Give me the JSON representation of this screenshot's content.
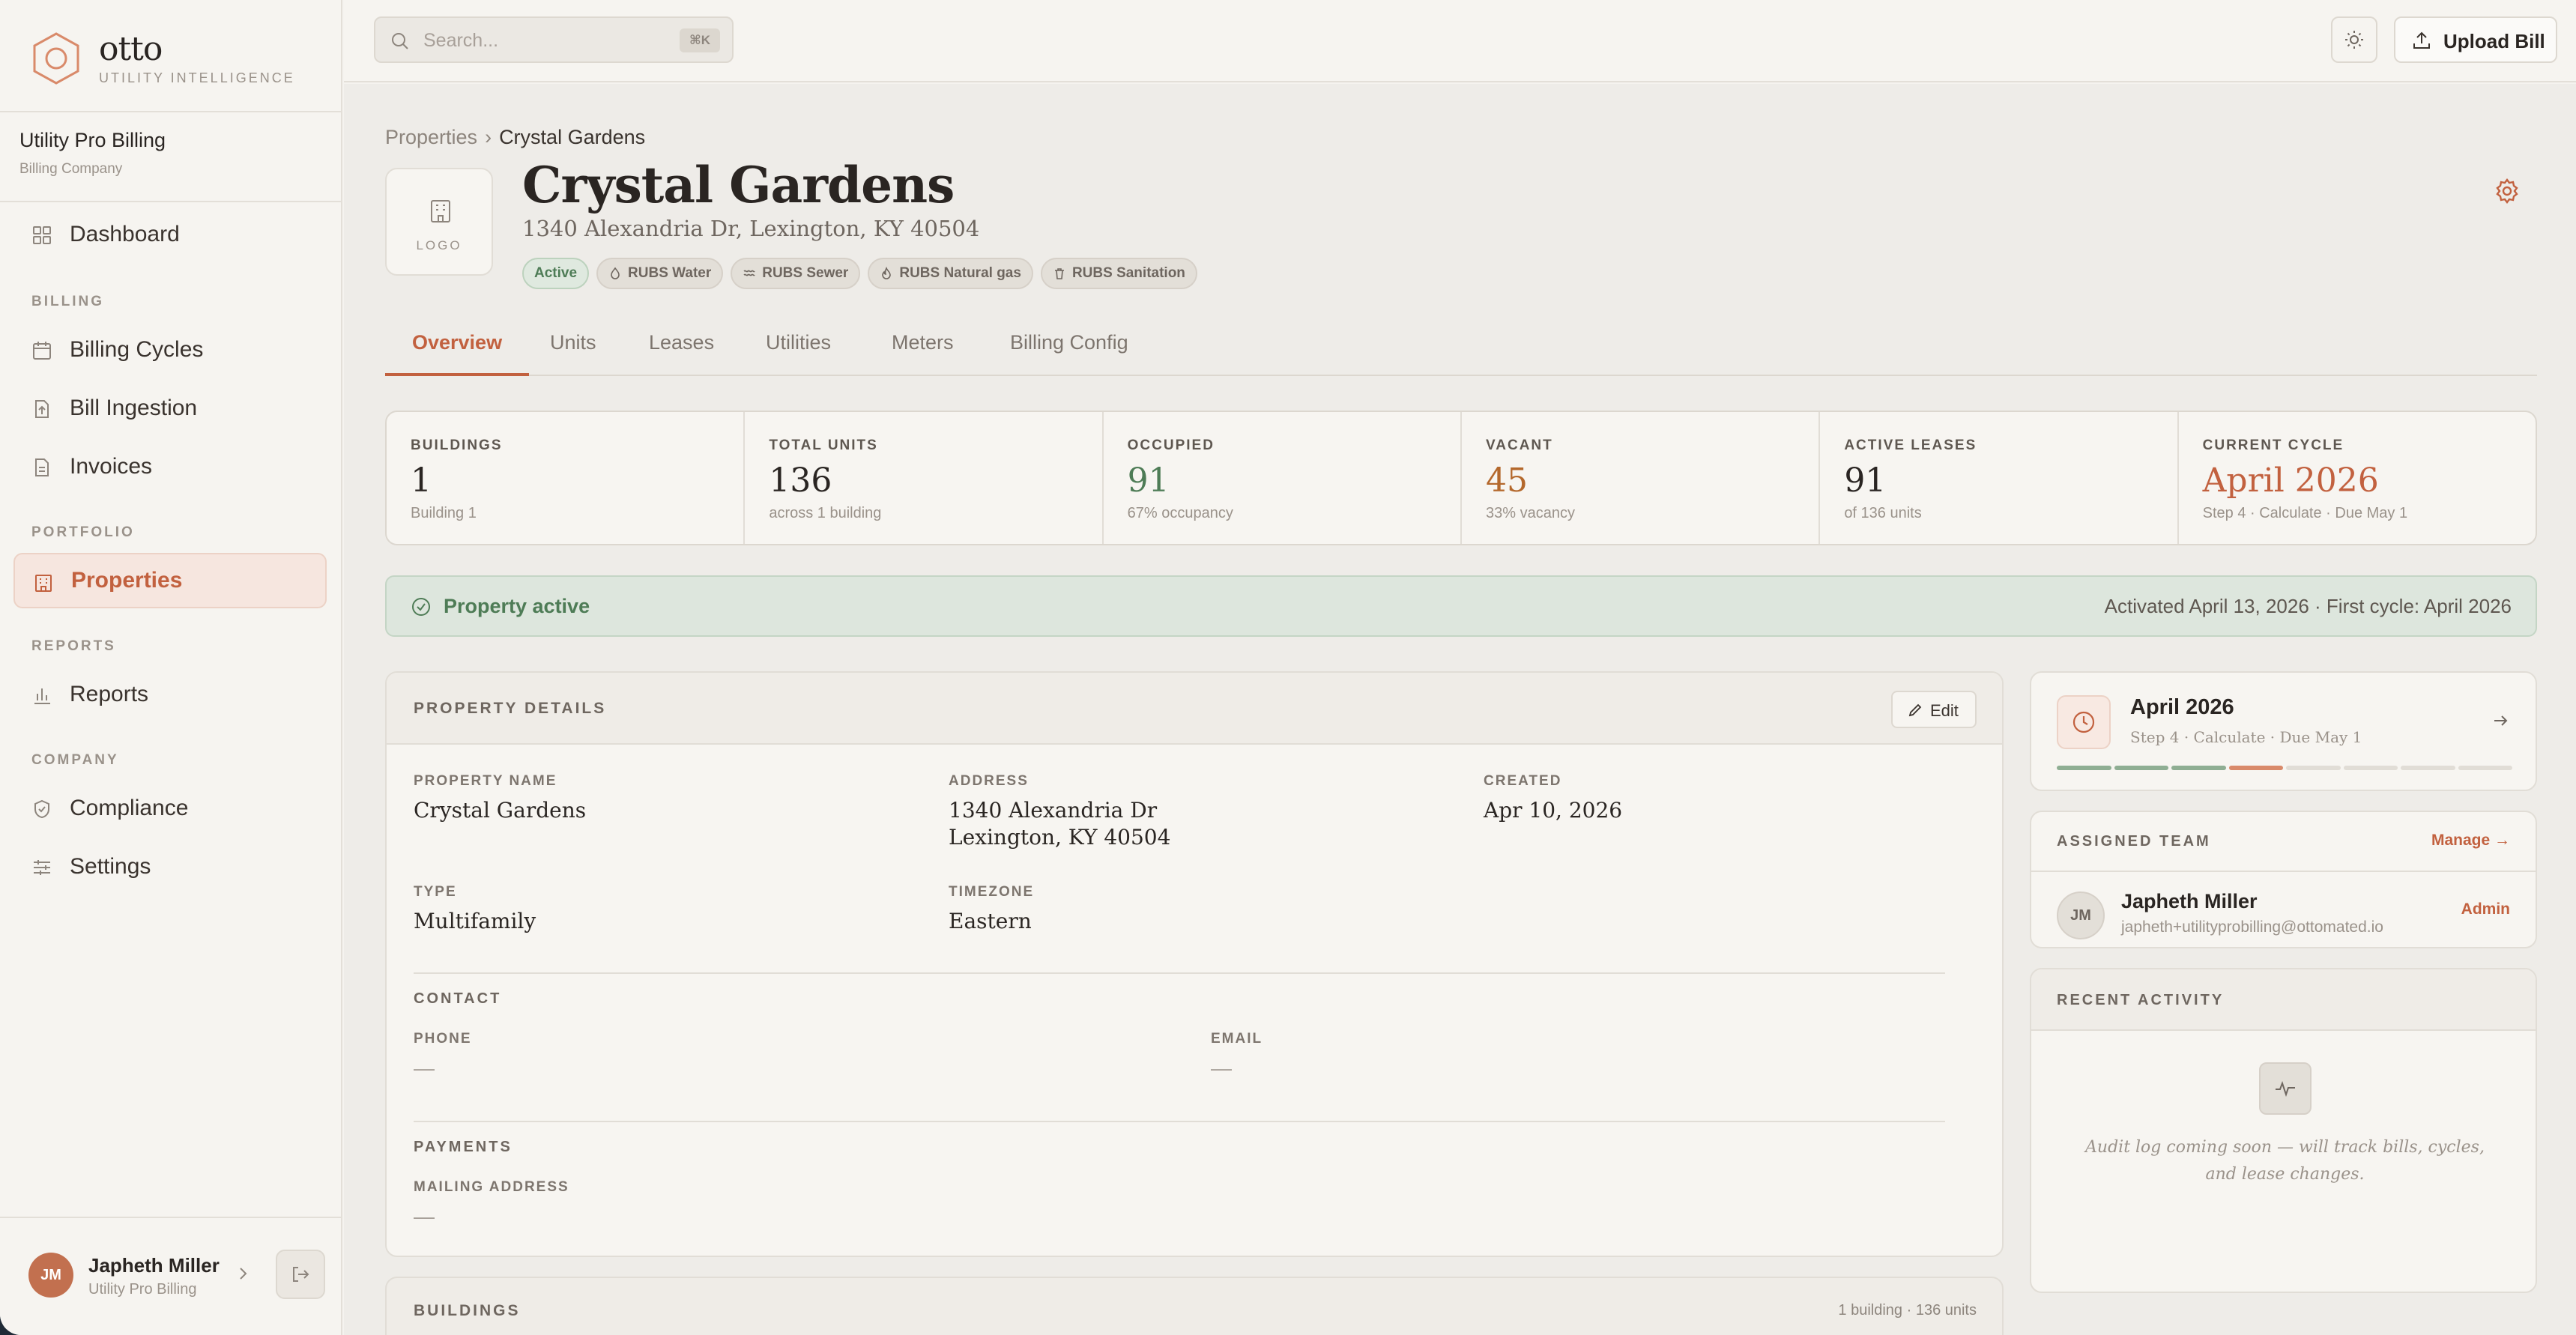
{
  "brand": {
    "name": "otto",
    "tagline": "UTILITY INTELLIGENCE"
  },
  "org": {
    "name": "Utility Pro Billing",
    "type": "Billing Company"
  },
  "nav": {
    "dashboard": "Dashboard",
    "sections": {
      "billing": "BILLING",
      "portfolio": "PORTFOLIO",
      "reports": "REPORTS",
      "company": "COMPANY"
    },
    "billing_cycles": "Billing Cycles",
    "bill_ingestion": "Bill Ingestion",
    "invoices": "Invoices",
    "properties": "Properties",
    "reports": "Reports",
    "compliance": "Compliance",
    "settings": "Settings"
  },
  "user": {
    "initials": "JM",
    "name": "Japheth Miller",
    "org": "Utility Pro Billing"
  },
  "topbar": {
    "search_placeholder": "Search...",
    "search_shortcut": "⌘K",
    "upload_label": "Upload Bill"
  },
  "breadcrumb": {
    "parent": "Properties",
    "separator": "›",
    "current": "Crystal Gardens"
  },
  "property": {
    "logo_label": "LOGO",
    "title": "Crystal Gardens",
    "address": "1340 Alexandria Dr, Lexington, KY 40504",
    "badges": [
      "Active",
      "RUBS Water",
      "RUBS Sewer",
      "RUBS Natural gas",
      "RUBS Sanitation"
    ]
  },
  "tabs": [
    "Overview",
    "Units",
    "Leases",
    "Utilities",
    "Meters",
    "Billing Config"
  ],
  "stats": [
    {
      "label": "BUILDINGS",
      "value": "1",
      "sub": "Building 1"
    },
    {
      "label": "TOTAL UNITS",
      "value": "136",
      "sub": "across 1 building"
    },
    {
      "label": "OCCUPIED",
      "value": "91",
      "sub": "67% occupancy"
    },
    {
      "label": "VACANT",
      "value": "45",
      "sub": "33% vacancy"
    },
    {
      "label": "ACTIVE LEASES",
      "value": "91",
      "sub": "of 136 units"
    },
    {
      "label": "CURRENT CYCLE",
      "value": "April 2026",
      "sub": "Step 4 · Calculate · Due May 1"
    }
  ],
  "status_bar": {
    "label": "Property active",
    "meta": "Activated April 13, 2026 · First cycle: April 2026"
  },
  "details": {
    "heading": "PROPERTY DETAILS",
    "edit_label": "Edit",
    "property_name_label": "PROPERTY NAME",
    "property_name": "Crystal Gardens",
    "address_label": "ADDRESS",
    "address_line1": "1340 Alexandria Dr",
    "address_line2": "Lexington, KY 40504",
    "created_label": "CREATED",
    "created": "Apr 10, 2026",
    "type_label": "TYPE",
    "type": "Multifamily",
    "timezone_label": "TIMEZONE",
    "timezone": "Eastern",
    "contact_heading": "CONTACT",
    "phone_label": "PHONE",
    "phone": "—",
    "email_label": "EMAIL",
    "email": "—",
    "payments_heading": "PAYMENTS",
    "mailing_label": "MAILING ADDRESS",
    "mailing": "—"
  },
  "buildings": {
    "heading": "BUILDINGS",
    "meta": "1 building · 136 units"
  },
  "cycle": {
    "title": "April 2026",
    "sub": "Step 4 · Calculate · Due May 1",
    "steps_total": 8,
    "steps_done": 3,
    "current_step": 4,
    "colors": {
      "done": "#8fae93",
      "current": "#d98a6a",
      "todo": "#e1ddd6"
    }
  },
  "team": {
    "heading": "ASSIGNED TEAM",
    "manage_label": "Manage →",
    "member": {
      "initials": "JM",
      "name": "Japheth Miller",
      "email": "japheth+utilityprobilling@ottomated.io",
      "role": "Admin"
    }
  },
  "activity": {
    "heading": "RECENT ACTIVITY",
    "text": "Audit log coming soon — will track bills, cycles, and lease changes."
  },
  "colors": {
    "accent": "#c2613f",
    "success": "#4e7c56",
    "warning": "#b4682c"
  }
}
